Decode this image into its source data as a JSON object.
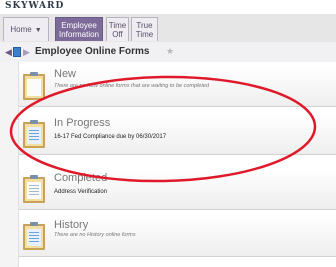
{
  "header": {
    "logo_text": "SKYWARD"
  },
  "tabs": [
    {
      "label": "Home",
      "caret": "▼"
    },
    {
      "label_line1": "Employee",
      "label_line2": "Information"
    },
    {
      "label_line1": "Time",
      "label_line2": "Off"
    },
    {
      "label_line1": "True",
      "label_line2": "Time"
    }
  ],
  "page": {
    "title": "Employee Online Forms"
  },
  "sections": {
    "new": {
      "title": "New",
      "description": "There are no New online forms that are waiting to be completed"
    },
    "in_progress": {
      "title": "In Progress",
      "link": "16-17 Fed Compliance due by 06/30/2017"
    },
    "completed": {
      "title": "Completed",
      "link": "Address Verification"
    },
    "history": {
      "title": "History",
      "description": "There are no History online forms"
    }
  },
  "colors": {
    "active_tab": "#7c6b98",
    "annotation_ellipse": "#e0192a"
  }
}
